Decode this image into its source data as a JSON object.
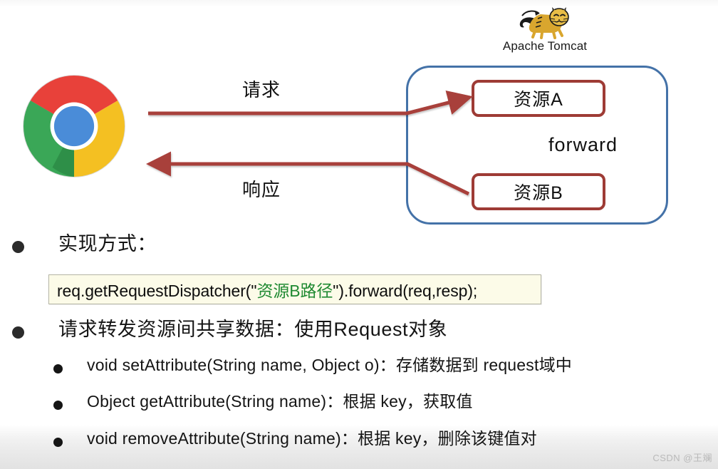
{
  "slide": {
    "title_bullets": [
      {
        "level": 1,
        "text": "实现方式："
      },
      {
        "level": 1,
        "text": "请求转发资源间共享数据：使用Request对象"
      }
    ],
    "sub_bullets": [
      "void setAttribute(String name, Object o)：存储数据到 request域中",
      "Object getAttribute(String name)：根据 key，获取值",
      "void removeAttribute(String name)：根据 key，删除该键值对"
    ]
  },
  "code_callout": {
    "prefix": "req.getRequestDispatcher(\"",
    "highlight": "资源B路径",
    "suffix": "\").forward(req,resp);",
    "highlight_color": "#1f8a32",
    "background_color": "#fcfbe8",
    "border_color": "#b4b4a4"
  },
  "diagram": {
    "client": {
      "icon": "chrome-logo",
      "colors": {
        "red": "#e8413a",
        "green": "#3aa757",
        "yellow": "#f4c022",
        "blue": "#4a8cd8"
      }
    },
    "server": {
      "logo_label": "Apache Tomcat",
      "logo_icon": "tomcat-cat-logo",
      "container_border_color": "#4472a8",
      "boxes": [
        {
          "id": "res-a",
          "label": "资源A"
        },
        {
          "id": "res-b",
          "label": "资源B"
        }
      ],
      "box_border_color": "#9e3b35"
    },
    "arrows": [
      {
        "id": "request-arrow",
        "label": "请求",
        "direction": "right",
        "color": "#a8403a"
      },
      {
        "id": "response-arrow",
        "label": "响应",
        "direction": "left",
        "color": "#a8403a"
      },
      {
        "id": "forward-arrow",
        "label": "forward",
        "direction": "down",
        "color": "#a8403a"
      }
    ]
  },
  "watermark": {
    "text": "CSDN @王斓"
  }
}
